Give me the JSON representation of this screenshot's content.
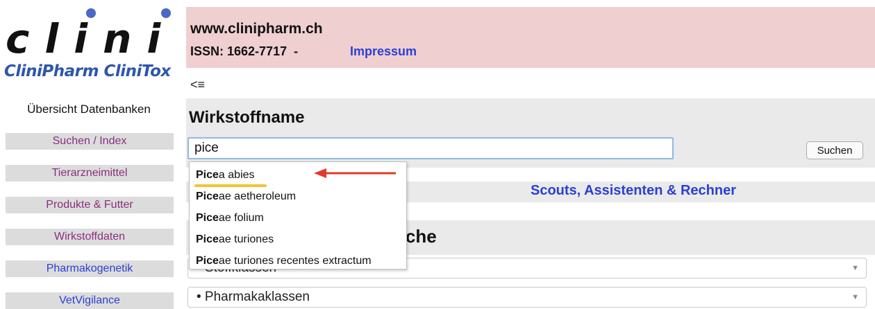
{
  "sidebar": {
    "logo_word": "clini",
    "logo_subtitle": "CliniPharm CliniTox",
    "overview_label": "Übersicht Datenbanken",
    "nav": [
      {
        "label": "Suchen / Index",
        "color": "purple"
      },
      {
        "label": "Tierarzneimittel",
        "color": "purple"
      },
      {
        "label": "Produkte & Futter",
        "color": "purple"
      },
      {
        "label": "Wirkstoffdaten",
        "color": "purple"
      },
      {
        "label": "Pharmakogenetik",
        "color": "blue"
      },
      {
        "label": "VetVigilance",
        "color": "blue"
      }
    ]
  },
  "header": {
    "site": "www.clinipharm.ch",
    "issn": "ISSN: 1662-7717  -",
    "impressum": "Impressum",
    "background": "#f0cfd1"
  },
  "back_menu": "<≡",
  "search": {
    "title": "Wirkstoffname",
    "input_value": "pice",
    "button_label": "Suchen"
  },
  "links": {
    "scouts": "Scouts, Assistenten & Rechner"
  },
  "section2": {
    "title_suffix": "uche"
  },
  "selects": [
    {
      "label": "• Stoffklassen"
    },
    {
      "label": "• Pharmakaklassen"
    }
  ],
  "autocomplete": {
    "items": [
      {
        "match": "Pice",
        "rest": "a abies"
      },
      {
        "match": "Pice",
        "rest": "ae aetheroleum"
      },
      {
        "match": "Pice",
        "rest": "ae folium"
      },
      {
        "match": "Pice",
        "rest": "ae turiones"
      },
      {
        "match": "Pice",
        "rest": "ae turiones recentes extractum"
      }
    ],
    "highlight_color": "#f4c430",
    "arrow_color": "#e03a2a"
  },
  "colors": {
    "link_blue": "#2a3fd4",
    "link_purple": "#8a2e7e",
    "logo_blue": "#2f56a9"
  }
}
